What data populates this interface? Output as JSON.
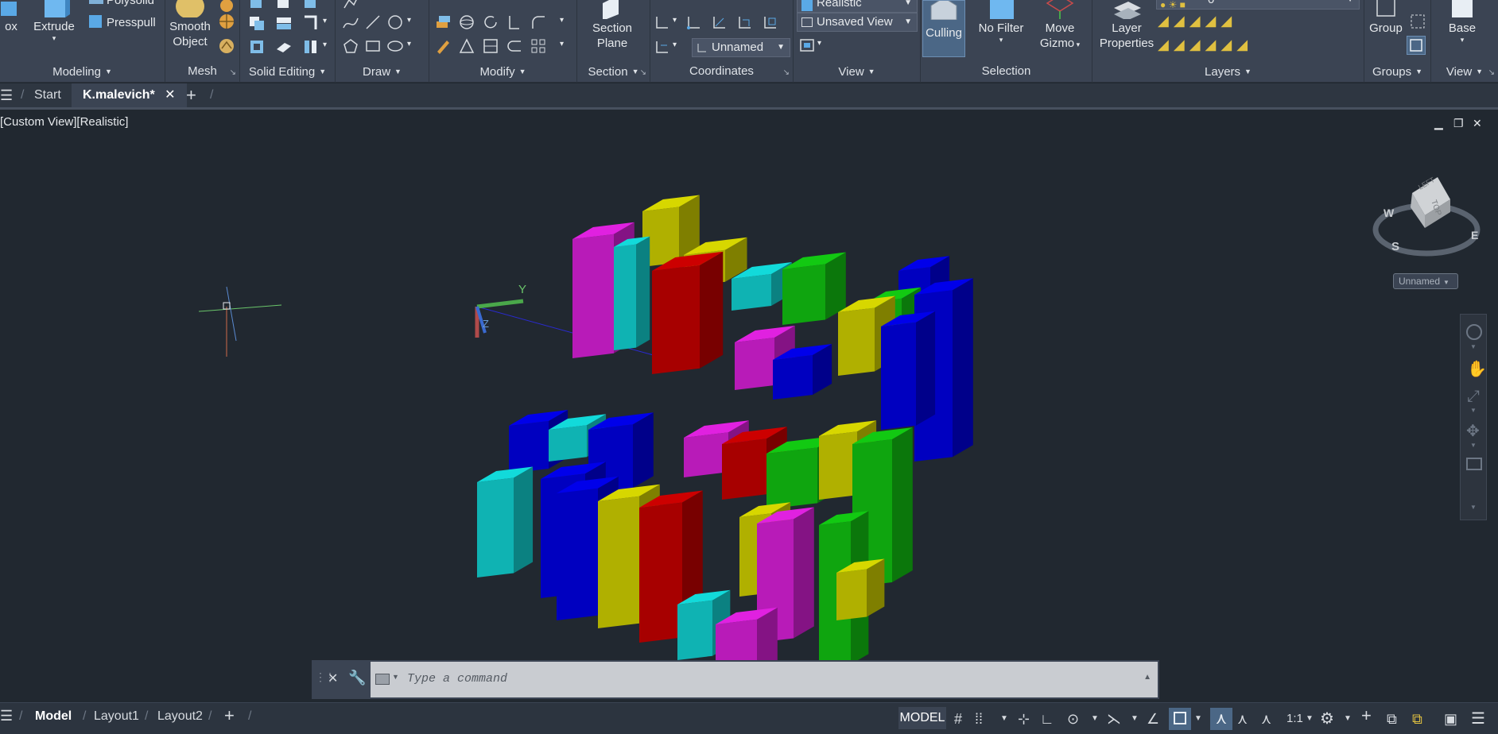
{
  "ribbon": {
    "panels": {
      "modeling": "Modeling",
      "mesh": "Mesh",
      "solid_editing": "Solid Editing",
      "draw": "Draw",
      "modify": "Modify",
      "section": "Section",
      "coordinates": "Coordinates",
      "view": "View",
      "selection": "Selection",
      "layers": "Layers",
      "groups": "Groups",
      "view2": "View"
    },
    "buttons": {
      "box": "ox",
      "extrude": "Extrude",
      "polysolid": "Polysolid",
      "presspull": "Presspull",
      "smooth_object_1": "Smooth",
      "smooth_object_2": "Object",
      "section_plane_1": "Section",
      "section_plane_2": "Plane",
      "culling": "Culling",
      "no_filter": "No Filter",
      "move_gizmo_1": "Move",
      "move_gizmo_2": "Gizmo",
      "layer_properties_1": "Layer",
      "layer_properties_2": "Properties",
      "group": "Group",
      "base": "Base"
    },
    "dropdowns": {
      "visual_style": "Realistic",
      "named_view": "Unsaved View",
      "ucs": "Unnamed",
      "layer_current": "0"
    }
  },
  "tabs": {
    "start": "Start",
    "drawing": "K.malevich*"
  },
  "viewport": {
    "label": "[Custom View][Realistic]",
    "ucs_y": "Y",
    "ucs_z": "Z",
    "viewcube": {
      "top": "TOP",
      "left": "LEFT",
      "w": "W",
      "s": "S",
      "e": "E",
      "ucs_menu": "Unnamed"
    }
  },
  "command": {
    "placeholder": "Type a command"
  },
  "status": {
    "layouts": [
      "Model",
      "Layout1",
      "Layout2"
    ],
    "model": "MODEL",
    "scale": "1:1"
  },
  "colors": {
    "magenta": "#b81bb8",
    "cyan": "#0fb3b3",
    "yellow": "#b0b000",
    "red": "#a70000",
    "green": "#0fa50f",
    "blue": "#0000c0"
  }
}
